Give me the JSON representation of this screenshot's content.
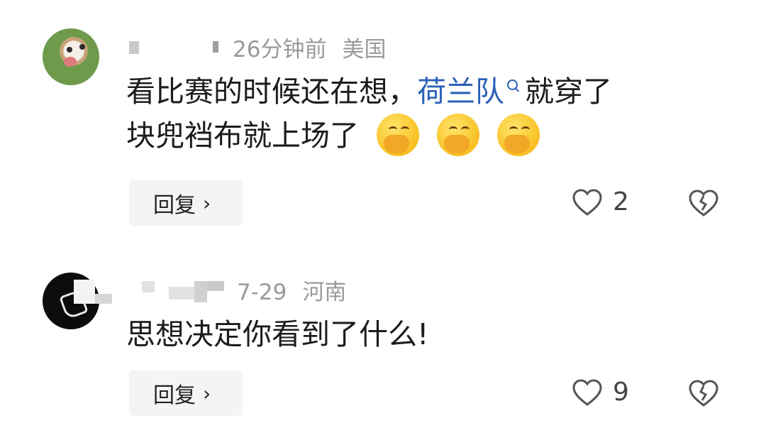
{
  "comments": [
    {
      "time": "26分钟前",
      "location": "美国",
      "text_before": "看比赛的时候还在想，",
      "link_text": "荷兰队",
      "text_after_line1": "就穿了",
      "text_line2": "块兜裆布就上场了",
      "emoji_count": 3,
      "reply_label": "回复",
      "likes": "2"
    },
    {
      "time": "7-29",
      "location": "河南",
      "text_line1": "思想决定你看到了什么!",
      "reply_label": "回复",
      "likes": "9"
    }
  ],
  "icons": {
    "reply_chevron": "chevron-right-icon",
    "like": "heart-outline-icon",
    "dislike": "broken-heart-icon",
    "link_search": "search-icon",
    "emoji": "face-with-hand-over-mouth-icon"
  },
  "colors": {
    "link": "#2b62b8",
    "meta": "#9a9a9a",
    "reply_bg": "#f4f4f4"
  }
}
